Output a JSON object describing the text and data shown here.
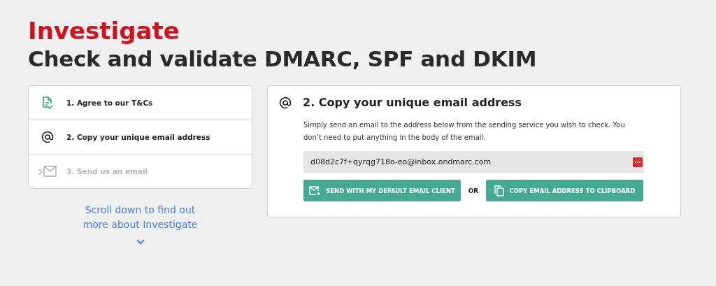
{
  "header": {
    "eyebrow": "Investigate",
    "title": "Check and validate DMARC, SPF and DKIM"
  },
  "steps": [
    {
      "kind": "document",
      "label": "1. Agree to our T&Cs",
      "disabled": false
    },
    {
      "kind": "at",
      "label": "2. Copy your unique email address",
      "disabled": false
    },
    {
      "kind": "envelope",
      "label": "3. Send us an email",
      "disabled": true
    }
  ],
  "scroll_hint": {
    "text": "Scroll down to find out more about Investigate"
  },
  "panel": {
    "title": "2. Copy your unique email address",
    "description": "Simply send an email to the address below from the sending service you wish to check. You don’t need to put anything in the body of the email.",
    "address": "d08d2c7f+qyrqg718o-eo@inbox.ondmarc.com",
    "send_button": "SEND WITH MY DEFAULT EMAIL CLIENT",
    "separator": "OR",
    "copy_button": "COPY EMAIL ADDRESS TO CLIPBOARD"
  }
}
